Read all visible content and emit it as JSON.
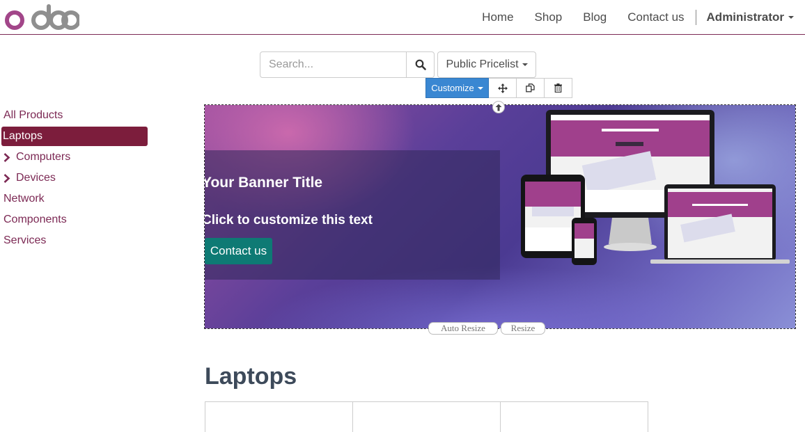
{
  "brand": {
    "logo_text": "odoo"
  },
  "navbar": {
    "links": [
      "Home",
      "Shop",
      "Blog",
      "Contact us"
    ],
    "user": "Administrator"
  },
  "search": {
    "placeholder": "Search..."
  },
  "pricelist": {
    "label": "Public Pricelist"
  },
  "editor": {
    "customize_label": "Customize"
  },
  "sidebar": {
    "items": [
      {
        "label": "All Products",
        "active": false,
        "has_children": false
      },
      {
        "label": "Laptops",
        "active": true,
        "has_children": false
      },
      {
        "label": "Computers",
        "active": false,
        "has_children": true
      },
      {
        "label": "Devices",
        "active": false,
        "has_children": true
      },
      {
        "label": "Network",
        "active": false,
        "has_children": false
      },
      {
        "label": "Components",
        "active": false,
        "has_children": false
      },
      {
        "label": "Services",
        "active": false,
        "has_children": false
      }
    ]
  },
  "banner": {
    "title": "Your Banner Title",
    "subtitle": "Click to customize this text",
    "button": "Contact us"
  },
  "resize": {
    "auto_label": "Auto Resize",
    "label": "Resize"
  },
  "category": {
    "title": "Laptops"
  },
  "colors": {
    "brand": "#7c2954",
    "active_category": "#7c1d3c",
    "customize_button": "#3a87d2",
    "banner_button": "#0e7a74"
  }
}
